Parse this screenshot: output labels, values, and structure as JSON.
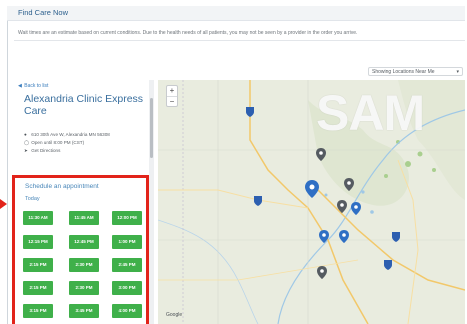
{
  "header": {
    "title": "Find Care Now"
  },
  "notice": "Wait times are an estimate based on current conditions. Due to the health needs of all patients, you may not be seen by a provider in the order you arrive.",
  "sort": {
    "selected": "Showing Locations Near Me"
  },
  "sidebar": {
    "back_label": "Back to list",
    "clinic_name": "Alexandria Clinic Express Care",
    "address": "610 30th Ave W, Alexandria MN 56308",
    "hours": "Open until 8:00 PM (CST)",
    "directions": "Get Directions"
  },
  "appointments": {
    "title": "Schedule an appointment",
    "day": "Today",
    "slots": [
      "11:30 AM",
      "11:45 AM",
      "12:00 PM",
      "12:15 PM",
      "12:45 PM",
      "1:00 PM",
      "2:15 PM",
      "2:30 PM",
      "2:45 PM",
      "2:15 PM",
      "2:30 PM",
      "3:00 PM",
      "3:15 PM",
      "3:45 PM",
      "4:00 PM"
    ]
  },
  "map": {
    "watermark": "SAM",
    "zoom_in": "+",
    "zoom_out": "−",
    "credit": "Google"
  },
  "colors": {
    "accent_blue": "#3a6f9e",
    "slot_green": "#3fb04a",
    "highlight_red": "#e2231a",
    "pin_blue": "#2f6fc4",
    "pin_gray": "#555b61"
  }
}
